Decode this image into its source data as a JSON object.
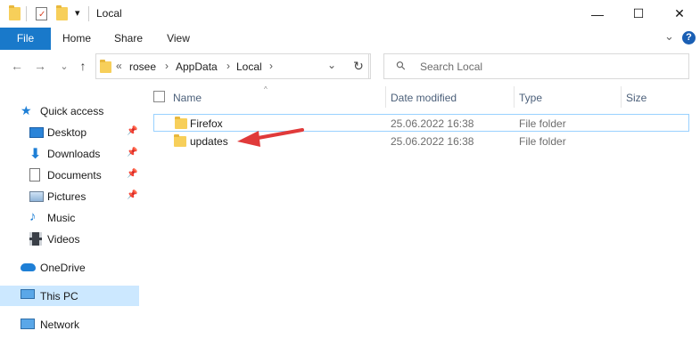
{
  "window": {
    "title": "Local",
    "minimize_glyph": "—",
    "maximize_glyph": "☐",
    "close_glyph": "✕",
    "quick_access_dropdown_glyph": "▾"
  },
  "ribbon": {
    "tabs": [
      "File",
      "Home",
      "Share",
      "View"
    ],
    "expand_glyph": "⌄",
    "help_glyph": "?"
  },
  "navigation": {
    "back_glyph": "←",
    "forward_glyph": "→",
    "recent_glyph": "⌄",
    "up_glyph": "↑",
    "refresh_glyph": "↻",
    "address_dropdown_glyph": "⌄"
  },
  "address": {
    "overflow": "«",
    "crumbs": [
      "rosee",
      "AppData",
      "Local"
    ],
    "separator": "›"
  },
  "search": {
    "placeholder": "Search Local",
    "icon_glyph": "⚲"
  },
  "sidebar": {
    "pin_glyph": "📌",
    "items": [
      {
        "label": "Quick access",
        "icon": "star-icon",
        "pinned": false
      },
      {
        "label": "Desktop",
        "icon": "desktop-icon",
        "pinned": true
      },
      {
        "label": "Downloads",
        "icon": "download-icon",
        "pinned": true
      },
      {
        "label": "Documents",
        "icon": "document-icon",
        "pinned": true
      },
      {
        "label": "Pictures",
        "icon": "picture-icon",
        "pinned": true
      },
      {
        "label": "Music",
        "icon": "music-icon",
        "pinned": false
      },
      {
        "label": "Videos",
        "icon": "video-icon",
        "pinned": false
      },
      {
        "label": "OneDrive",
        "icon": "cloud-icon",
        "pinned": false
      },
      {
        "label": "This PC",
        "icon": "computer-icon",
        "pinned": false,
        "selected": true
      },
      {
        "label": "Network",
        "icon": "network-icon",
        "pinned": false
      }
    ]
  },
  "columns": {
    "name": "Name",
    "date_modified": "Date modified",
    "type": "Type",
    "size": "Size",
    "sort_glyph": "^"
  },
  "files": [
    {
      "name": "Firefox",
      "date_modified": "25.06.2022 16:38",
      "type": "File folder",
      "size": ""
    },
    {
      "name": "updates",
      "date_modified": "25.06.2022 16:38",
      "type": "File folder",
      "size": ""
    }
  ],
  "colors": {
    "file_tab": "#1979ca",
    "selection_border": "#99d1ff",
    "selected_nav": "#cce8ff",
    "annotation_arrow": "#e03a3a",
    "folder": "#f7cf5a"
  }
}
